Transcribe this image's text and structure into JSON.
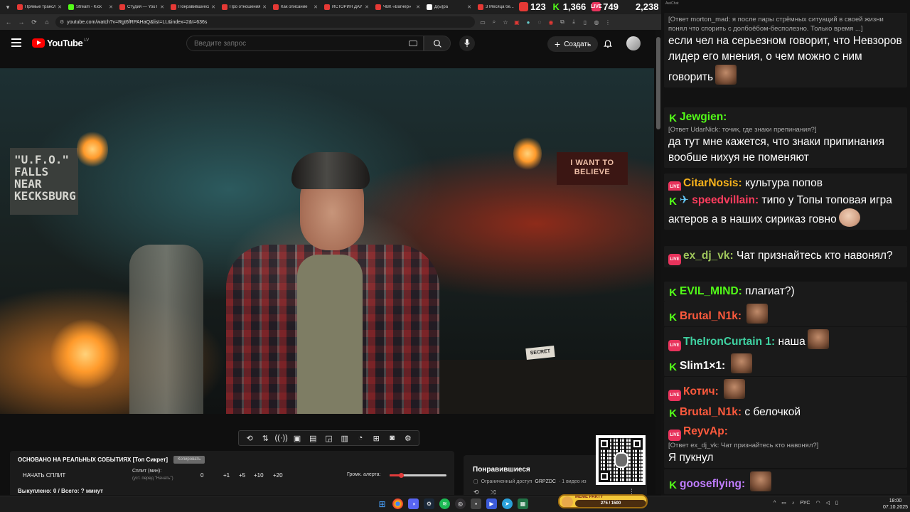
{
  "browser": {
    "tabs": [
      {
        "title": "Прямые трансляции",
        "color": "#e53935"
      },
      {
        "title": "Stream - Kick",
        "color": "#53fc18"
      },
      {
        "title": "Студия — YouTube",
        "color": "#e53935"
      },
      {
        "title": "Понравившиеся",
        "color": "#e53935"
      },
      {
        "title": "Про отношения",
        "color": "#e53935"
      },
      {
        "title": "Как описание",
        "color": "#e53935"
      },
      {
        "title": "ИСТОРИЯ ДАУ",
        "color": "#e53935"
      },
      {
        "title": "ЧВК «Вагнер»",
        "color": "#e53935"
      },
      {
        "title": "Д(ы)ра",
        "color": "#ffffff"
      },
      {
        "title": "3 Месяца бе...",
        "color": "#e53935"
      }
    ],
    "url": "youtube.com/watch?v=Rgt6fRPAHaQ&list=LL&index=2&t=636s"
  },
  "counters": [
    {
      "value": "123",
      "icon": "youtube-icon",
      "label": "",
      "color": "#e53935"
    },
    {
      "value": "1,366",
      "icon": "kick-icon",
      "label": "K",
      "color": "#53fc18"
    },
    {
      "value": "749",
      "icon": "vk-live-icon",
      "label": "LIVE",
      "color": "#e8335c"
    },
    {
      "value": "2,238",
      "icon": "users-icon",
      "label": "",
      "color": "#ffffff"
    }
  ],
  "youtube": {
    "logo_text": "YouTube",
    "region": "LV",
    "search_placeholder": "Введите запрос",
    "create_label": "Создать"
  },
  "video": {
    "poster_lines": [
      "\"U.F.O.\"",
      "FALLS NEAR",
      "KECKSBURG"
    ],
    "sign_lines": [
      "I WANT TO",
      "BELIEVE"
    ],
    "note": "SECRET"
  },
  "split": {
    "title": "ОСНОВАНО НА РЕАЛЬНЫХ СОБЫТИЯХ [Топ Сикрет]",
    "badge": "Копировать",
    "start": "НАЧАТЬ СПЛИТ",
    "split_label": "Сплит (мин):",
    "split_hint": "(уст. перед \"Начать\")",
    "value": "0",
    "increments": [
      "+1",
      "+5",
      "+10",
      "+20"
    ],
    "alert_label": "Громк. алерта:",
    "alert_level": 0.2,
    "bought": "Выкуплено: 0 / Всего: ? минут"
  },
  "liked": {
    "title": "Понравившиеся",
    "access": "Ограниченный доступ",
    "author": "GRPZDC",
    "count": "· 1 видео из"
  },
  "chat": {
    "title": "AwiChat",
    "messages": [
      {
        "platform": "",
        "nick": "",
        "color": "",
        "reply": "[Ответ morton_mad: я после пары стрёмных ситуаций в своей жизни понял что спорить с долбоёбом-бесполезно. Только время ...]",
        "text": "если чел на серьезном говорит, что Невзоров лидер его мнения, о чем можно с ним говорить",
        "emote": true
      },
      {
        "platform": "K",
        "nick": "Jewgien:",
        "color": "#53fc18",
        "reply": "[Ответ UdarNick: точик, где знаки препинания?]",
        "text": "да тут мне кажется, что знаки припинания вообше нихуя не поменяют",
        "emote": false
      },
      {
        "platform": "LIVE",
        "nick": "CitarNosis:",
        "color": "#f6b21b",
        "reply": "",
        "text": "культура попов",
        "emote": false
      },
      {
        "platform": "K",
        "nick": "speedvillain:",
        "color": "#ff3d5e",
        "reply": "",
        "text": "типо у Топы топовая игра актеров а в наших сириказ говно",
        "emote": true
      },
      {
        "platform": "LIVE",
        "nick": "ex_dj_vk:",
        "color": "#9ec55b",
        "reply": "",
        "text": "Чат признайтесь кто навонял?",
        "emote": false
      },
      {
        "platform": "K",
        "nick": "EVIL_MIND:",
        "color": "#53fc18",
        "reply": "",
        "text": "плагиат?)",
        "emote": false
      },
      {
        "platform": "K",
        "nick": "Brutal_N1k:",
        "color": "#ff5a3d",
        "reply": "",
        "text": "",
        "emote": true
      },
      {
        "platform": "LIVE",
        "nick": "TheIronCurtain 1:",
        "color": "#3fd1a1",
        "reply": "",
        "text": "наша",
        "emote": true
      },
      {
        "platform": "K",
        "nick": "Slim1×1:",
        "color": "#ffffff",
        "reply": "",
        "text": "",
        "emote": true
      },
      {
        "platform": "LIVE",
        "nick": "Котич:",
        "color": "#ff5a3d",
        "reply": "",
        "text": "",
        "emote": true
      },
      {
        "platform": "K",
        "nick": "Brutal_N1k:",
        "color": "#ff5a3d",
        "reply": "",
        "text": "с белочкой",
        "emote": false
      },
      {
        "platform": "LIVE",
        "nick": "ReyvAp:",
        "color": "#ff5a3d",
        "reply": "[Ответ ex_dj_vk: Чат признайтесь кто навонял?]",
        "text": "Я пукнул",
        "emote": false
      },
      {
        "platform": "K",
        "nick": "gooseflying:",
        "color": "#c07dff",
        "reply": "",
        "text": "",
        "emote": true
      }
    ]
  },
  "taskbar": {
    "meme_title": "MEME PARTY",
    "meme_progress": "275 / 1500",
    "lang": "РУС",
    "time": "18:00",
    "date": "07.10.2025"
  }
}
